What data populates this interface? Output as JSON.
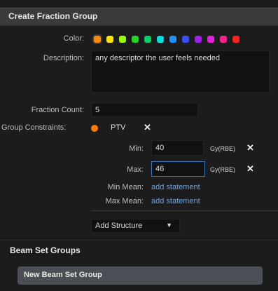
{
  "header": {
    "title": "Create Fraction Group"
  },
  "color": {
    "label": "Color:",
    "swatches": [
      "#ff8a00",
      "#ffe600",
      "#9cff00",
      "#22d422",
      "#00d26a",
      "#00dede",
      "#1e90ff",
      "#3a4dff",
      "#a020f0",
      "#e81fe0",
      "#ff2090",
      "#ff2020"
    ],
    "selected_index": 0
  },
  "description": {
    "label": "Description:",
    "value": "any descriptor the user feels needed"
  },
  "fraction_count": {
    "label": "Fraction Count:",
    "value": "5"
  },
  "group_constraints": {
    "label": "Group Constraints:",
    "structure_color": "#ff7a00",
    "structure": "PTV",
    "min_label": "Min:",
    "min_value": "40",
    "min_unit": "Gy(RBE)",
    "max_label": "Max:",
    "max_value": "46",
    "max_unit": "Gy(RBE)",
    "min_mean_label": "Min Mean:",
    "min_mean_link": "add statement",
    "max_mean_label": "Max Mean:",
    "max_mean_link": "add statement"
  },
  "add_structure": {
    "label": "Add Structure",
    "icon": "caret-down"
  },
  "beam_set_groups": {
    "title": "Beam Set Groups",
    "button_label": "New Beam Set Group"
  }
}
